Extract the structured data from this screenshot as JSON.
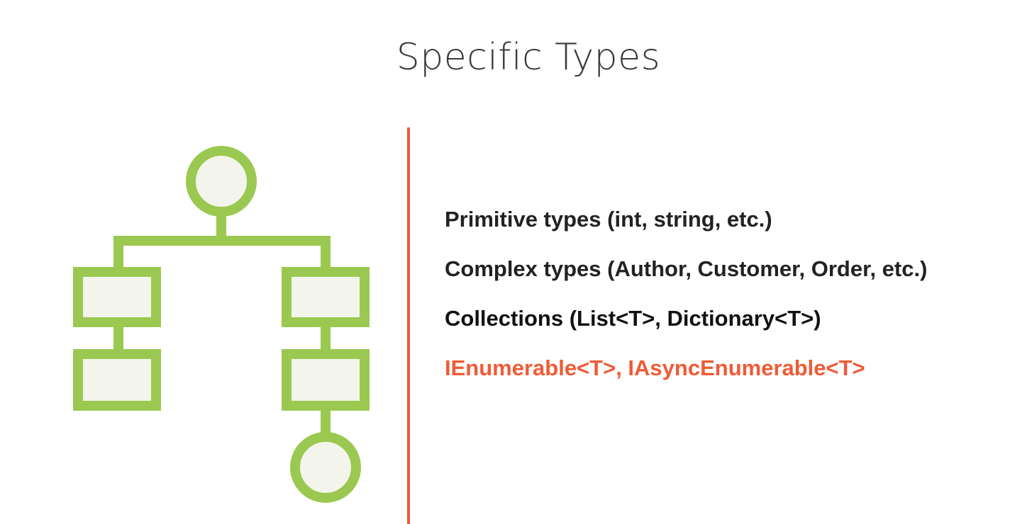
{
  "slide": {
    "title": "Specific Types"
  },
  "items": [
    {
      "text": "Primitive types (int, string, etc.)",
      "color": "#222222"
    },
    {
      "text": "Complex types (Author, Customer, Order, etc.)",
      "color": "#222222"
    },
    {
      "text": "Collections (List<T>, Dictionary<T>)",
      "color": "#111111"
    },
    {
      "text": "IEnumerable<T>, IAsyncEnumerable<T>",
      "color": "#ef5b36"
    }
  ],
  "colors": {
    "icon_stroke": "#9bc850",
    "icon_fill": "#f3f5ec",
    "divider": "#ef5b36",
    "title": "#3a3a3a"
  },
  "icon": {
    "name": "hierarchy-diagram-icon"
  }
}
